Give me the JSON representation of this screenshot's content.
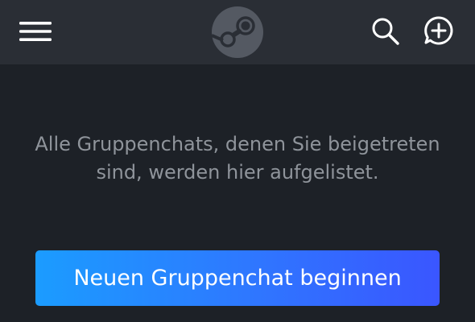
{
  "header": {
    "menu_icon": "hamburger-menu-icon",
    "logo_icon": "steam-logo-icon",
    "search_icon": "search-icon",
    "new_chat_icon": "chat-bubble-plus-icon"
  },
  "main": {
    "empty_message": "Alle Gruppenchats, denen Sie beigetreten sind, werden hier aufgelistet.",
    "start_button_label": "Neuen Gruppenchat beginnen"
  },
  "colors": {
    "background": "#1d2127",
    "header": "#2a2e35",
    "muted_text": "#8f949b",
    "button_gradient_start": "#1b9cff",
    "button_gradient_end": "#3a56ff"
  }
}
